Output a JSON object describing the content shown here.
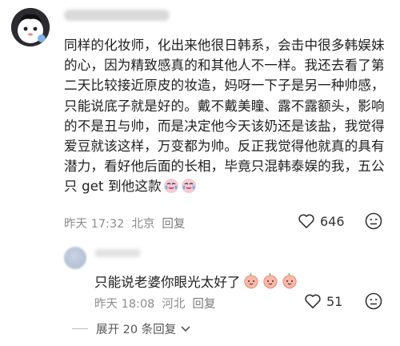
{
  "comment": {
    "text": "同样的化妆师，化出来他很日韩系，会击中很多韩娱妹的心，因为精致感真的和其他人不一样。我还去看了第二天比较接近原皮的妆造，妈呀一下子是另一种帅感，只能说底子就是好的。戴不戴美瞳、露不露额头，影响的不是丑与帅，而是决定他今天该奶还是该盐，我觉得爱豆就该这样，万变都为帅。反正我觉得他就真的具有潜力，看好他后面的长相，毕竟只混韩泰娱的我，五公只 get 到他这款",
    "time": "昨天 17:32",
    "location": "北京",
    "reply_label": "回复",
    "like_count": "646",
    "emojis": [
      "crying-laugh-emoji",
      "crying-laugh-emoji"
    ]
  },
  "reply": {
    "text": "只能说老婆你眼光太好了",
    "time": "昨天 18:08",
    "location": "河北",
    "reply_label": "回复",
    "like_count": "51",
    "emojis": [
      "peach-emoji",
      "peach-emoji",
      "peach-emoji"
    ]
  },
  "expand_label": "展开 20 条回复",
  "icons": {
    "like": "heart-outline-icon",
    "dislike": "dislike-face-icon"
  }
}
